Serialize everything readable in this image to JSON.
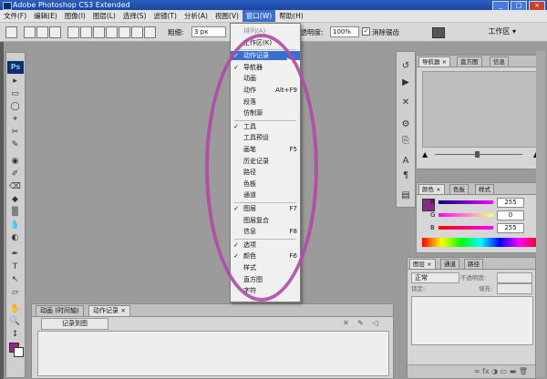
{
  "title_bar": {
    "title": "Adobe Photoshop CS3 Extended",
    "minimize": "_",
    "maximize": "□",
    "close": "×"
  },
  "menu": [
    "文件(F)",
    "编辑(E)",
    "图像(I)",
    "图层(L)",
    "选择(S)",
    "滤镜(T)",
    "分析(A)",
    "视图(V)",
    "窗口(W)",
    "帮助(H)"
  ],
  "options": {
    "brush_label": "粗细:",
    "brush_value": "3 px",
    "opacity_label": "不透明度:",
    "opacity_value": "100%",
    "antialias_label": "消除锯齿",
    "antialias_check": "✓",
    "workspace": "工作区 ▾"
  },
  "window_menu": [
    {
      "check": "",
      "label": "排列(A)",
      "shortcut": "",
      "state": "dim"
    },
    {
      "check": "",
      "label": "工作区(K)",
      "shortcut": "",
      "state": ""
    },
    {
      "check": "✓",
      "label": "动作记录",
      "shortcut": "",
      "state": "hl"
    },
    {
      "check": "✓",
      "label": "导航器",
      "shortcut": "",
      "state": ""
    },
    {
      "check": "",
      "label": "动画",
      "shortcut": "",
      "state": ""
    },
    {
      "check": "",
      "label": "动作",
      "shortcut": "Alt+F9",
      "state": ""
    },
    {
      "check": "",
      "label": "段落",
      "shortcut": "",
      "state": ""
    },
    {
      "check": "",
      "label": "仿制源",
      "shortcut": "",
      "state": ""
    },
    {
      "check": "✓",
      "label": "工具",
      "shortcut": "",
      "state": ""
    },
    {
      "check": "",
      "label": "工具预设",
      "shortcut": "",
      "state": ""
    },
    {
      "check": "",
      "label": "画笔",
      "shortcut": "F5",
      "state": ""
    },
    {
      "check": "",
      "label": "历史记录",
      "shortcut": "",
      "state": ""
    },
    {
      "check": "",
      "label": "路径",
      "shortcut": "",
      "state": ""
    },
    {
      "check": "",
      "label": "色板",
      "shortcut": "",
      "state": ""
    },
    {
      "check": "",
      "label": "通道",
      "shortcut": "",
      "state": ""
    },
    {
      "check": "✓",
      "label": "图层",
      "shortcut": "F7",
      "state": ""
    },
    {
      "check": "",
      "label": "图层复合",
      "shortcut": "",
      "state": ""
    },
    {
      "check": "",
      "label": "信息",
      "shortcut": "F8",
      "state": ""
    },
    {
      "check": "✓",
      "label": "选项",
      "shortcut": "",
      "state": ""
    },
    {
      "check": "✓",
      "label": "颜色",
      "shortcut": "F6",
      "state": ""
    },
    {
      "check": "",
      "label": "样式",
      "shortcut": "",
      "state": ""
    },
    {
      "check": "",
      "label": "直方图",
      "shortcut": "",
      "state": ""
    },
    {
      "check": "",
      "label": "字符",
      "shortcut": "",
      "state": ""
    }
  ],
  "toolbox": {
    "logo": "Ps",
    "tools": [
      "▸",
      "▭",
      "◯",
      "⌖",
      "✂",
      "✎",
      "◉",
      "✐",
      "⌫",
      "◆",
      "▒",
      "💧",
      "◐",
      "✒",
      "T",
      "↖",
      "▱",
      "✋",
      "🔍",
      "↕"
    ]
  },
  "anim_panel": {
    "tabs": [
      "动画 (时间轴)",
      "动作记录 ×"
    ],
    "record_btn": "记录到图",
    "icons": [
      "✕",
      "✎",
      "◁"
    ]
  },
  "navigator": {
    "tabs": [
      "导航器 ×",
      "直方图",
      "信息"
    ]
  },
  "color_panel": {
    "tabs": [
      "颜色 ×",
      "色板",
      "样式"
    ],
    "r_label": "R",
    "g_label": "G",
    "b_label": "B",
    "r_value": "255",
    "g_value": "0",
    "b_value": "255",
    "r_pct": 1,
    "g_pct": 0,
    "b_pct": 1
  },
  "layers_panel": {
    "tabs": [
      "图层 ×",
      "通道",
      "路径"
    ],
    "blend_mode": "正常",
    "opacity_label": "不透明度:",
    "lock_label": "锁定:",
    "fill_label": "填充:",
    "bottom_icons": "∞ fx ◑ ▭ ▬ 🗑"
  },
  "colors": {
    "highlight": "#3a6fd0",
    "annotation": "#b04aa6",
    "foreground": "#8b2a8b"
  }
}
